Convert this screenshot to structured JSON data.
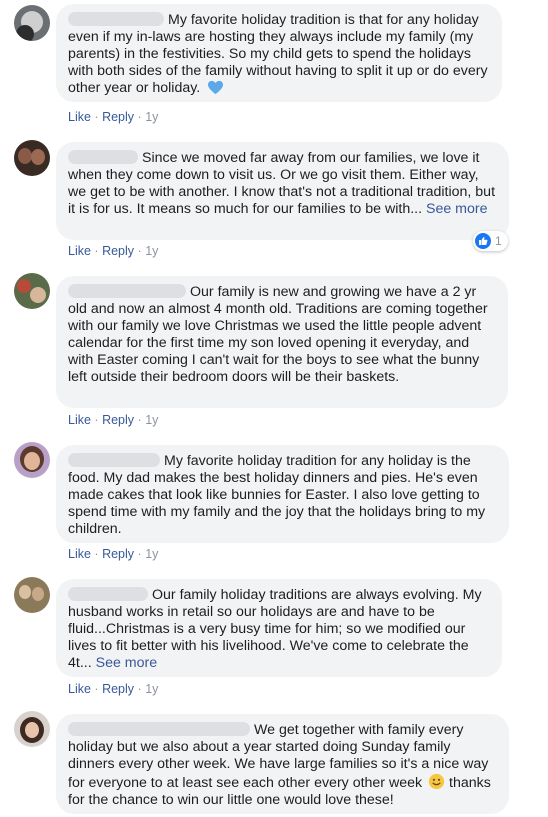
{
  "comments": [
    {
      "text": "My favorite holiday tradition is that for any holiday even if my in-laws are hosting they always include my family (my parents) in the festivities. So my child gets to spend the holidays with both sides of the family without having to split it up or do every other year or holiday.",
      "emoji": "blue-heart",
      "like": "Like",
      "reply": "Reply",
      "sep": "·",
      "time": "1y"
    },
    {
      "text": "Since we moved far away from our families, we love it when they come down to visit us. Or we go visit them. Either way, we get to be with another. I know that's not a traditional tradition, but it is for us. It means so much for our families to be with...",
      "see_more": "See more",
      "like": "Like",
      "reply": "Reply",
      "sep": "·",
      "time": "1y",
      "reaction_count": "1"
    },
    {
      "text": "Our family is new and growing we have a 2 yr old and now an almost 4 month old. Traditions are coming together with our family we love Christmas we used the little people advent calendar for the first time my son loved opening it everyday, and with Easter coming I can't wait for the boys to see what the bunny left outside their bedroom doors will be their baskets.",
      "like": "Like",
      "reply": "Reply",
      "sep": "·",
      "time": "1y"
    },
    {
      "text": "My favorite holiday tradition for any holiday is the food. My dad makes the best holiday dinners and pies. He's even made cakes that look like bunnies for Easter. I also love getting to spend time with my family and the joy that the holidays bring to my children.",
      "like": "Like",
      "reply": "Reply",
      "sep": "·",
      "time": "1y"
    },
    {
      "text": "Our family holiday traditions are always evolving. My husband works in retail so our holidays are and have to be fluid...Christmas is a very busy time for him; so we modified our lives to fit better with his livelihood. We've come to celebrate the 4t...",
      "see_more": "See more",
      "like": "Like",
      "reply": "Reply",
      "sep": "·",
      "time": "1y"
    },
    {
      "text": "We get together with family every holiday but we also about a year started doing Sunday family dinners every other week. We have large families so it's a nice way for everyone to at least see each other every other week",
      "text_after": "thanks for the chance to win our little one would love these!",
      "emoji": "smile"
    }
  ]
}
